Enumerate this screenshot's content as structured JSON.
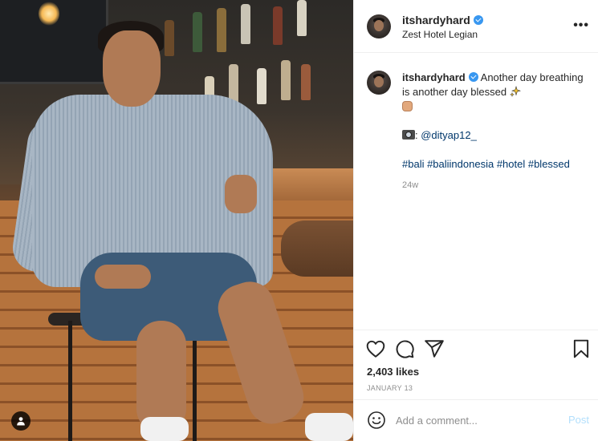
{
  "post": {
    "username": "itshardyhard",
    "location": "Zest Hotel Legian",
    "more_label": "•••"
  },
  "caption": {
    "username": "itshardyhard",
    "line1": "Another day breathing is another day blessed",
    "mention": "@dityap12_",
    "hashtags": "#bali #baliindonesia #hotel #blessed",
    "time_ago": "24w"
  },
  "actions": {
    "likes": "2,403 likes",
    "date": "January 13"
  },
  "comment": {
    "placeholder": "Add a comment...",
    "post_label": "Post"
  },
  "colors": {
    "verified": "#3897f0",
    "link": "#00376b",
    "post_disabled": "#b2dffc",
    "muted": "#8e8e8e"
  },
  "icons": {
    "like": "heart-icon",
    "comment": "comment-icon",
    "share": "paper-plane-icon",
    "save": "bookmark-icon",
    "emoji": "smiley-icon",
    "tag": "user-tag-icon",
    "more": "ellipsis-icon"
  }
}
